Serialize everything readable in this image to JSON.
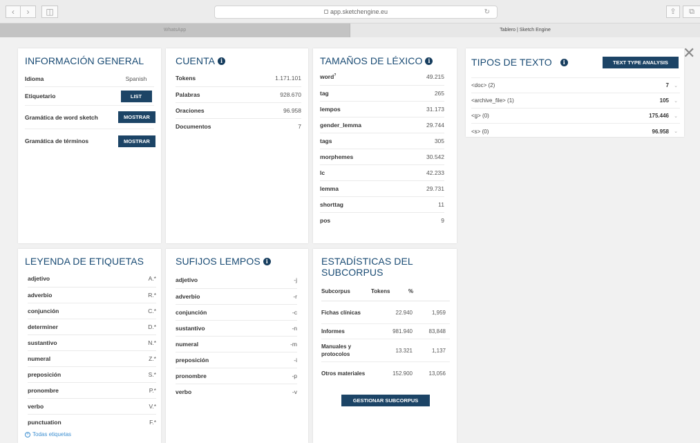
{
  "browser": {
    "address": "app.sketchengine.eu",
    "tabs": [
      {
        "label": "WhatsApp",
        "active": false
      },
      {
        "label": "Tablero | Sketch Engine",
        "active": true
      }
    ]
  },
  "general": {
    "title": "INFORMACIÓN GENERAL",
    "rows": [
      {
        "label": "Idioma",
        "value": "Spanish"
      },
      {
        "label": "Etiquetario",
        "button": "LIST"
      },
      {
        "label": "Gramática de word sketch",
        "button": "MOSTRAR"
      },
      {
        "label": "Gramática de términos",
        "button": "MOSTRAR"
      }
    ]
  },
  "cuenta": {
    "title": "CUENTA",
    "rows": [
      {
        "label": "Tokens",
        "value": "1.171.101"
      },
      {
        "label": "Palabras",
        "value": "928.670"
      },
      {
        "label": "Oraciones",
        "value": "96.958"
      },
      {
        "label": "Documentos",
        "value": "7"
      }
    ]
  },
  "lexicon": {
    "title": "TAMAÑOS DE LÉXICO",
    "rows": [
      {
        "label": "word",
        "sup": "?",
        "value": "49.215"
      },
      {
        "label": "tag",
        "value": "265"
      },
      {
        "label": "lempos",
        "value": "31.173"
      },
      {
        "label": "gender_lemma",
        "value": "29.744"
      },
      {
        "label": "tags",
        "value": "305"
      },
      {
        "label": "morphemes",
        "value": "30.542"
      },
      {
        "label": "lc",
        "value": "42.233"
      },
      {
        "label": "lemma",
        "value": "29.731"
      },
      {
        "label": "shorttag",
        "value": "11"
      },
      {
        "label": "pos",
        "value": "9"
      }
    ]
  },
  "text_types": {
    "title": "TIPOS DE TEXTO",
    "button": "TEXT TYPE ANALYSIS",
    "rows": [
      {
        "name": "<doc>",
        "sub": "(2)",
        "count": "7"
      },
      {
        "name": "<archive_file>",
        "sub": "(1)",
        "count": "105"
      },
      {
        "name": "<g>",
        "sub": "(0)",
        "count": "175.446"
      },
      {
        "name": "<s>",
        "sub": "(0)",
        "count": "96.958"
      }
    ]
  },
  "tags_legend": {
    "title": "LEYENDA DE ETIQUETAS",
    "rows": [
      {
        "label": "adjetivo",
        "value": "A.*"
      },
      {
        "label": "adverbio",
        "value": "R.*"
      },
      {
        "label": "conjunción",
        "value": "C.*"
      },
      {
        "label": "determiner",
        "value": "D.*"
      },
      {
        "label": "sustantivo",
        "value": "N.*"
      },
      {
        "label": "numeral",
        "value": "Z.*"
      },
      {
        "label": "preposición",
        "value": "S.*"
      },
      {
        "label": "pronombre",
        "value": "P.*"
      },
      {
        "label": "verbo",
        "value": "V.*"
      },
      {
        "label": "punctuation",
        "value": "F.*"
      }
    ],
    "link": "Todas etiquetas"
  },
  "suffixes": {
    "title": "SUFIJOS LEMPOS",
    "rows": [
      {
        "label": "adjetivo",
        "value": "-j"
      },
      {
        "label": "adverbio",
        "value": "-r"
      },
      {
        "label": "conjunción",
        "value": "-c"
      },
      {
        "label": "sustantivo",
        "value": "-n"
      },
      {
        "label": "numeral",
        "value": "-m"
      },
      {
        "label": "preposición",
        "value": "-i"
      },
      {
        "label": "pronombre",
        "value": "-p"
      },
      {
        "label": "verbo",
        "value": "-v"
      }
    ]
  },
  "subcorpus": {
    "title": "ESTADÍSTICAS DEL SUBCORPUS",
    "headers": [
      "Subcorpus",
      "Tokens",
      "%"
    ],
    "rows": [
      {
        "name": "Fichas clínicas",
        "tokens": "22.940",
        "pct": "1,959"
      },
      {
        "name": "Informes",
        "tokens": "981.940",
        "pct": "83,848"
      },
      {
        "name": "Manuales y protocolos",
        "tokens": "13.321",
        "pct": "1,137"
      },
      {
        "name": "Otros materiales",
        "tokens": "152.900",
        "pct": "13,056"
      }
    ],
    "button": "GESTIONAR SUBCORPUS"
  }
}
